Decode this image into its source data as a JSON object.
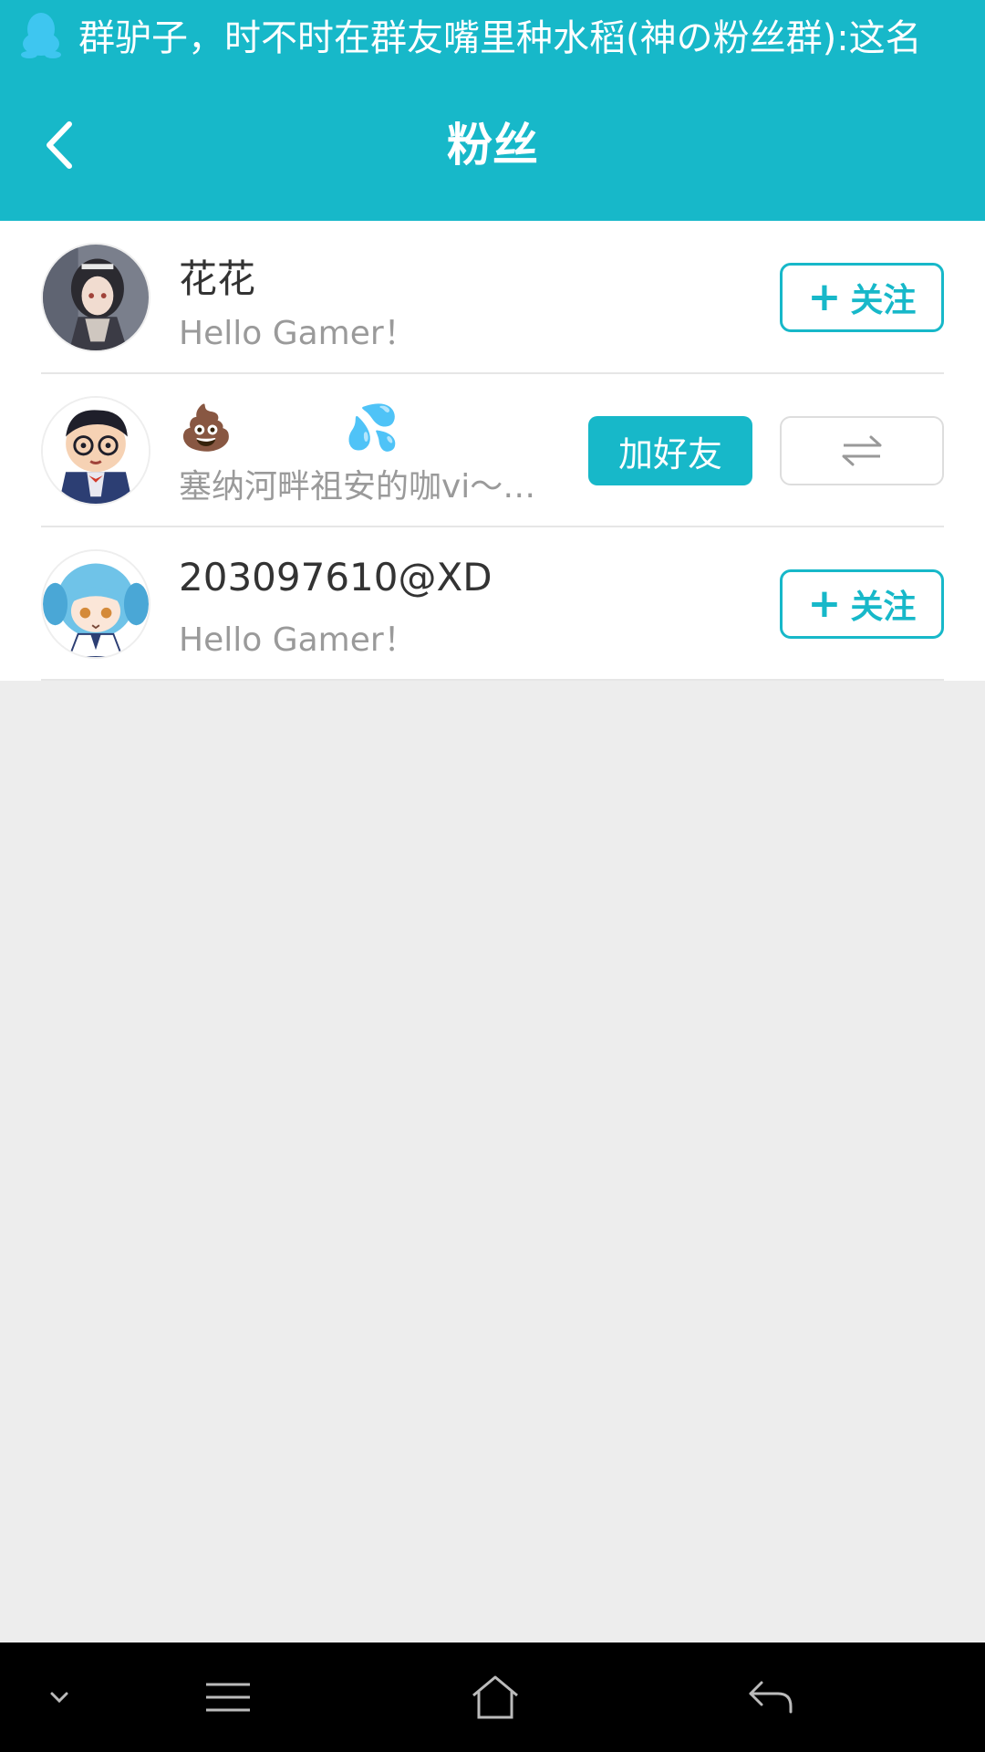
{
  "status_bar": {
    "notification_text": "群驴子，时不时在群友嘴里种水稻(神の粉丝群):这名"
  },
  "header": {
    "title": "粉丝"
  },
  "fans": [
    {
      "name": "花花",
      "bio": "Hello Gamer！",
      "action_label": "关注"
    },
    {
      "name_emoji_1": "💩",
      "name_emoji_2": "💦",
      "bio": "塞纳河畔祖安的咖vi～…",
      "add_friend_label": "加好友"
    },
    {
      "name": "203097610@XD",
      "bio": "Hello Gamer！",
      "action_label": "关注"
    }
  ],
  "colors": {
    "accent": "#17b8c9",
    "background": "#ededed"
  }
}
